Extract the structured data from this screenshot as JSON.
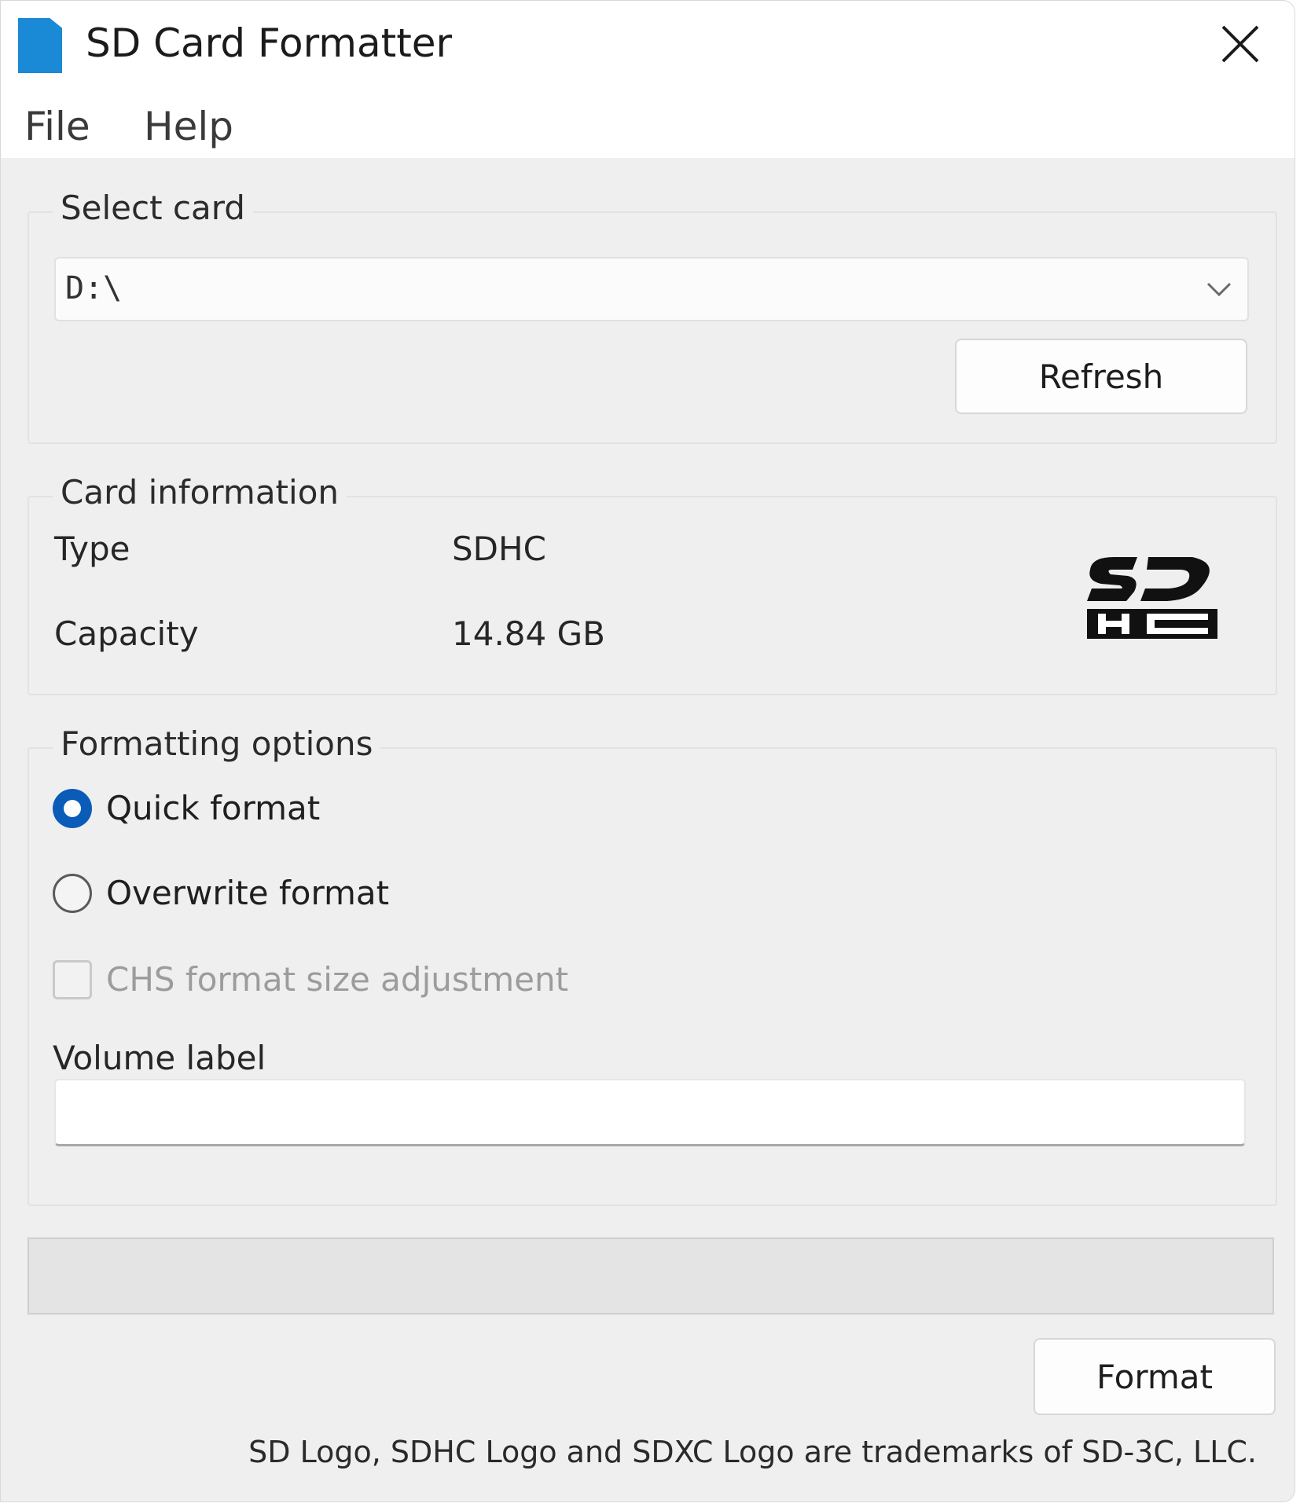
{
  "window": {
    "title": "SD Card Formatter",
    "accent_color": "#0a5cb8",
    "app_icon": "sd-card-icon",
    "close_icon": "close-icon"
  },
  "menu": {
    "items": [
      "File",
      "Help"
    ]
  },
  "select_card": {
    "group_title": "Select card",
    "selected_value": "D:\\",
    "dropdown_icon": "chevron-down-icon",
    "refresh_label": "Refresh"
  },
  "card_info": {
    "group_title": "Card information",
    "type_label": "Type",
    "type_value": "SDHC",
    "capacity_label": "Capacity",
    "capacity_value": "14.84 GB",
    "logo_icon": "sdhc-logo-icon"
  },
  "formatting": {
    "group_title": "Formatting options",
    "quick_label": "Quick format",
    "quick_checked": true,
    "overwrite_label": "Overwrite format",
    "overwrite_checked": false,
    "chs_label": "CHS format size adjustment",
    "chs_checked": false,
    "chs_enabled": false,
    "volume_label_title": "Volume label",
    "volume_label_value": ""
  },
  "progress": {
    "fraction": 0
  },
  "actions": {
    "format_label": "Format"
  },
  "footer": {
    "text": "SD Logo, SDHC Logo and SDXC Logo are trademarks of SD-3C, LLC."
  }
}
